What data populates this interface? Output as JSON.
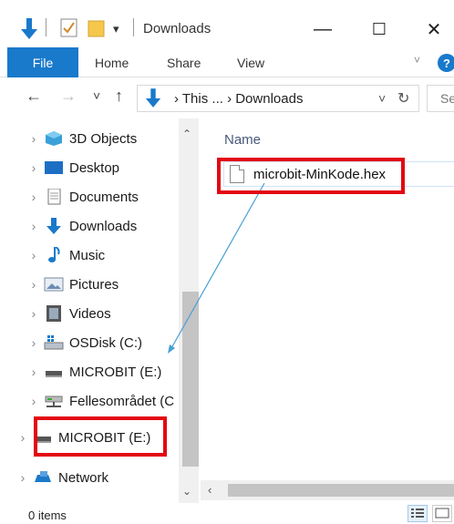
{
  "window": {
    "title": "Downloads",
    "minimize": "—",
    "maximize": "☐",
    "close": "✕"
  },
  "quick_access": {
    "dropdown": "▾"
  },
  "ribbon": {
    "tabs": [
      "File",
      "Home",
      "Share",
      "View"
    ],
    "collapse": "˅",
    "help": "?"
  },
  "nav": {
    "back": "←",
    "forward": "→",
    "recent": "˅",
    "up": "↑"
  },
  "address": {
    "path": "› This ... › Downloads",
    "dropdown": "˅",
    "refresh": "↻"
  },
  "search": {
    "placeholder": "Se"
  },
  "sidebar": {
    "items": [
      {
        "label": "3D Objects",
        "icon": "3d-objects-icon"
      },
      {
        "label": "Desktop",
        "icon": "desktop-icon"
      },
      {
        "label": "Documents",
        "icon": "documents-icon"
      },
      {
        "label": "Downloads",
        "icon": "downloads-icon"
      },
      {
        "label": "Music",
        "icon": "music-icon"
      },
      {
        "label": "Pictures",
        "icon": "pictures-icon"
      },
      {
        "label": "Videos",
        "icon": "videos-icon"
      },
      {
        "label": "OSDisk (C:)",
        "icon": "drive-icon"
      },
      {
        "label": "MICROBIT (E:)",
        "icon": "usb-drive-icon"
      },
      {
        "label": "Fellesområdet (C",
        "icon": "network-drive-icon"
      },
      {
        "label": "MICROBIT (E:)",
        "icon": "usb-drive-icon"
      },
      {
        "label": "Network",
        "icon": "network-icon"
      }
    ]
  },
  "content": {
    "column_name": "Name",
    "files": [
      {
        "name": "microbit-MinKode.hex"
      }
    ]
  },
  "status": {
    "items": "0 items"
  },
  "colors": {
    "accent": "#1979ca",
    "annotation": "#e30613",
    "arrow": "#4a9fd4"
  }
}
